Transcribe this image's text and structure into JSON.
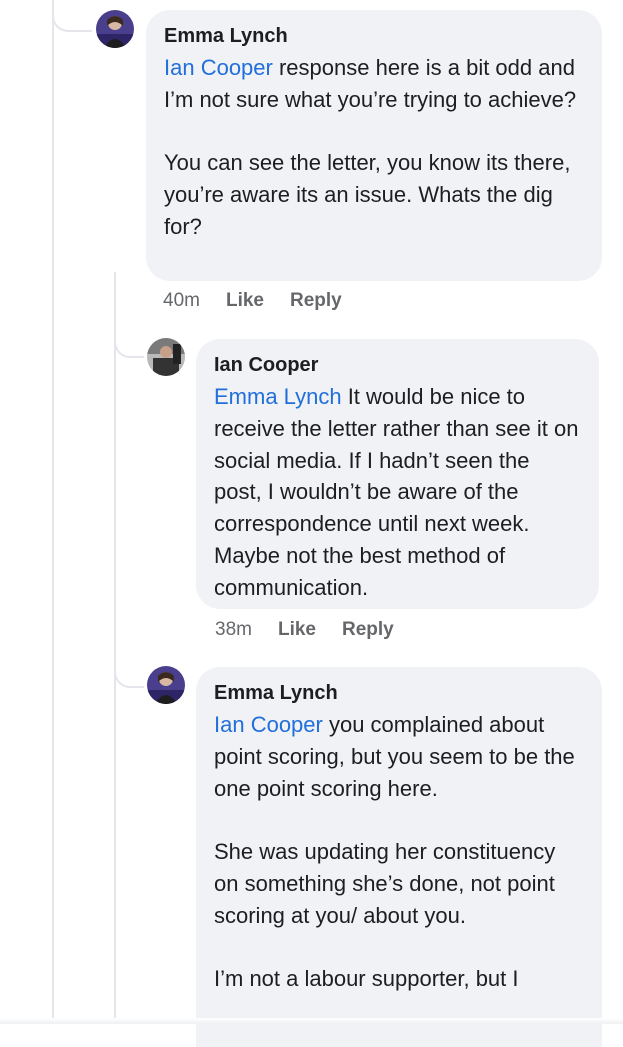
{
  "comments": [
    {
      "author": "Emma Lynch",
      "mention": "Ian Cooper",
      "text": " response here is a bit odd and I’m not sure what you’re trying to achieve?\n\nYou can see the letter, you know its there, you’re aware its an issue. Whats the dig for?",
      "time": "40m",
      "like": "Like",
      "reply": "Reply"
    },
    {
      "author": "Ian Cooper",
      "mention": "Emma Lynch",
      "text": " It would be nice to receive the letter rather than see it on social media. If I hadn’t seen the post, I wouldn’t be aware of the correspondence until next week. Maybe not the best method of communication.",
      "time": "38m",
      "like": "Like",
      "reply": "Reply"
    },
    {
      "author": "Emma Lynch",
      "mention": "Ian Cooper",
      "text": " you complained about point scoring, but you seem to be the one point scoring here.\n\nShe was updating her constituency on something she’s done, not point scoring at you/ about you.\n\nI’m not a labour supporter, but I"
    }
  ],
  "colors": {
    "bubble": "#f0f2f5",
    "mention": "#216fdb",
    "meta": "#65676b",
    "thread_line": "#e4e6eb"
  },
  "icons": {
    "emma_avatar": "avatar-emma-lynch",
    "ian_avatar": "avatar-ian-cooper"
  }
}
